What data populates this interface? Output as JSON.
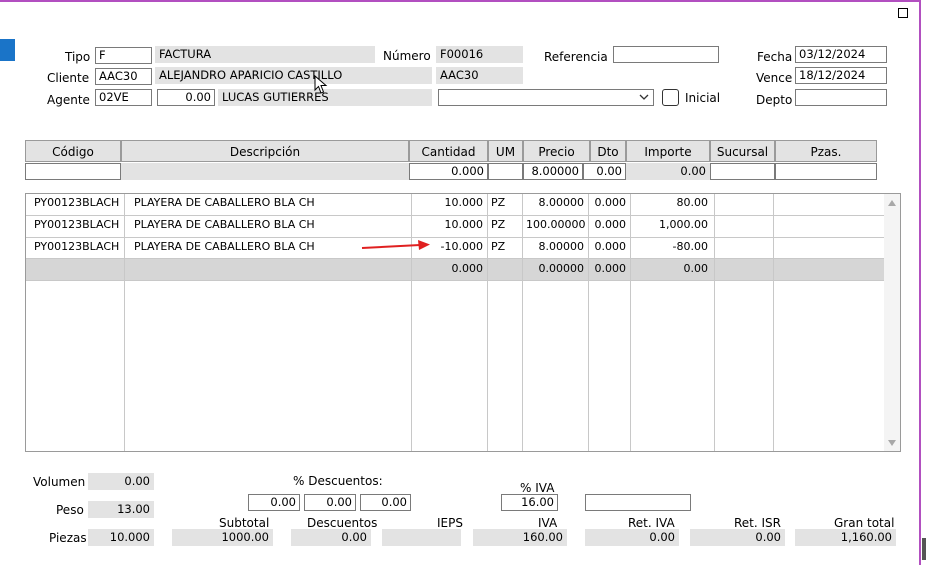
{
  "colors": {
    "window_border": "#b24fc0",
    "accent": "#1a74c8",
    "arrow": "#e02020",
    "readonly_bg": "#e3e3e3"
  },
  "window": {
    "close_icon": "square-icon"
  },
  "header": {
    "tipo": {
      "label": "Tipo",
      "code": "F",
      "name": "FACTURA"
    },
    "numero": {
      "label": "Número",
      "value": "F00016"
    },
    "referencia": {
      "label": "Referencia",
      "value": ""
    },
    "fecha": {
      "label": "Fecha",
      "value": "03/12/2024"
    },
    "cliente": {
      "label": "Cliente",
      "code": "AAC30",
      "name": "ALEJANDRO APARICIO CASTILLO",
      "alt_code": "AAC30"
    },
    "vence": {
      "label": "Vence",
      "value": "18/12/2024"
    },
    "agente": {
      "label": "Agente",
      "code": "02VE",
      "amount": "0.00",
      "name": "LUCAS GUTIERRES"
    },
    "combo": {
      "value": ""
    },
    "inicial": {
      "label": "Inicial",
      "checked": false
    },
    "depto": {
      "label": "Depto",
      "value": ""
    }
  },
  "grid": {
    "columns": [
      "Código",
      "Descripción",
      "Cantidad",
      "UM",
      "Precio",
      "Dto",
      "Importe",
      "Sucursal",
      "Pzas."
    ],
    "entry": {
      "codigo": "",
      "descripcion": "",
      "cantidad": "0.000",
      "um": "",
      "precio": "8.00000",
      "dto": "0.00",
      "importe": "0.00",
      "sucursal": "",
      "pzas": ""
    },
    "rows": [
      {
        "codigo": "PY00123BLACH",
        "descripcion": "PLAYERA DE CABALLERO BLA CH",
        "cantidad": "10.000",
        "um": "PZ",
        "precio": "8.00000",
        "dto": "0.000",
        "importe": "80.00"
      },
      {
        "codigo": "PY00123BLACH",
        "descripcion": "PLAYERA DE CABALLERO BLA CH",
        "cantidad": "10.000",
        "um": "PZ",
        "precio": "100.00000",
        "dto": "0.000",
        "importe": "1,000.00"
      },
      {
        "codigo": "PY00123BLACH",
        "descripcion": "PLAYERA DE CABALLERO BLA CH",
        "cantidad": "-10.000",
        "um": "PZ",
        "precio": "8.00000",
        "dto": "0.000",
        "importe": "-80.00"
      }
    ],
    "selected": {
      "cantidad": "0.000",
      "precio": "0.00000",
      "dto": "0.000",
      "importe": "0.00"
    }
  },
  "footer": {
    "volumen": {
      "label": "Volumen",
      "value": "0.00"
    },
    "peso": {
      "label": "Peso",
      "value": "13.00"
    },
    "piezas": {
      "label": "Piezas",
      "value": "10.000"
    },
    "descuentos_pct": {
      "label": "% Descuentos:",
      "values": [
        "0.00",
        "0.00",
        "0.00"
      ]
    },
    "iva_pct": {
      "label": "% IVA",
      "value": "16.00"
    },
    "extra": "",
    "totals": {
      "subtotal": {
        "label": "Subtotal",
        "value": "1000.00"
      },
      "descuentos": {
        "label": "Descuentos",
        "value": "0.00"
      },
      "ieps": {
        "label": "IEPS",
        "value": ""
      },
      "iva": {
        "label": "IVA",
        "value": "160.00"
      },
      "ret_iva": {
        "label": "Ret. IVA",
        "value": "0.00"
      },
      "ret_isr": {
        "label": "Ret. ISR",
        "value": "0.00"
      },
      "gran_total": {
        "label": "Gran total",
        "value": "1,160.00"
      }
    }
  }
}
